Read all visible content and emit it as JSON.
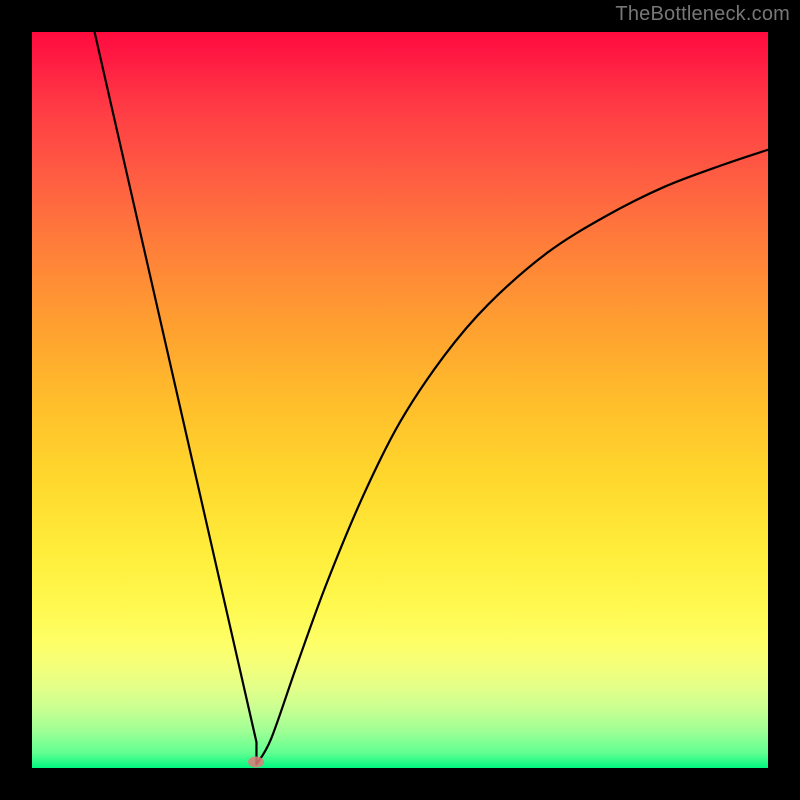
{
  "attribution": "TheBottleneck.com",
  "chart_data": {
    "type": "line",
    "title": "",
    "xlabel": "",
    "ylabel": "",
    "ylim": [
      0,
      100
    ],
    "xlim": [
      0,
      100
    ],
    "series": [
      {
        "name": "bottleneck-curve",
        "points": [
          {
            "x": 8.5,
            "y": 100
          },
          {
            "x": 30.5,
            "y": 3.5
          },
          {
            "x": 30.5,
            "y": 0.5
          },
          {
            "x": 32.5,
            "y": 4
          },
          {
            "x": 36,
            "y": 14
          },
          {
            "x": 40,
            "y": 25
          },
          {
            "x": 45,
            "y": 37
          },
          {
            "x": 50,
            "y": 47
          },
          {
            "x": 56,
            "y": 56
          },
          {
            "x": 62,
            "y": 63
          },
          {
            "x": 70,
            "y": 70
          },
          {
            "x": 78,
            "y": 75
          },
          {
            "x": 86,
            "y": 79
          },
          {
            "x": 94,
            "y": 82
          },
          {
            "x": 100,
            "y": 84
          }
        ]
      }
    ],
    "marker": {
      "x": 30.5,
      "y": 0.8
    },
    "background": "red-yellow-green vertical gradient",
    "axes_visible": false,
    "legend": false
  }
}
